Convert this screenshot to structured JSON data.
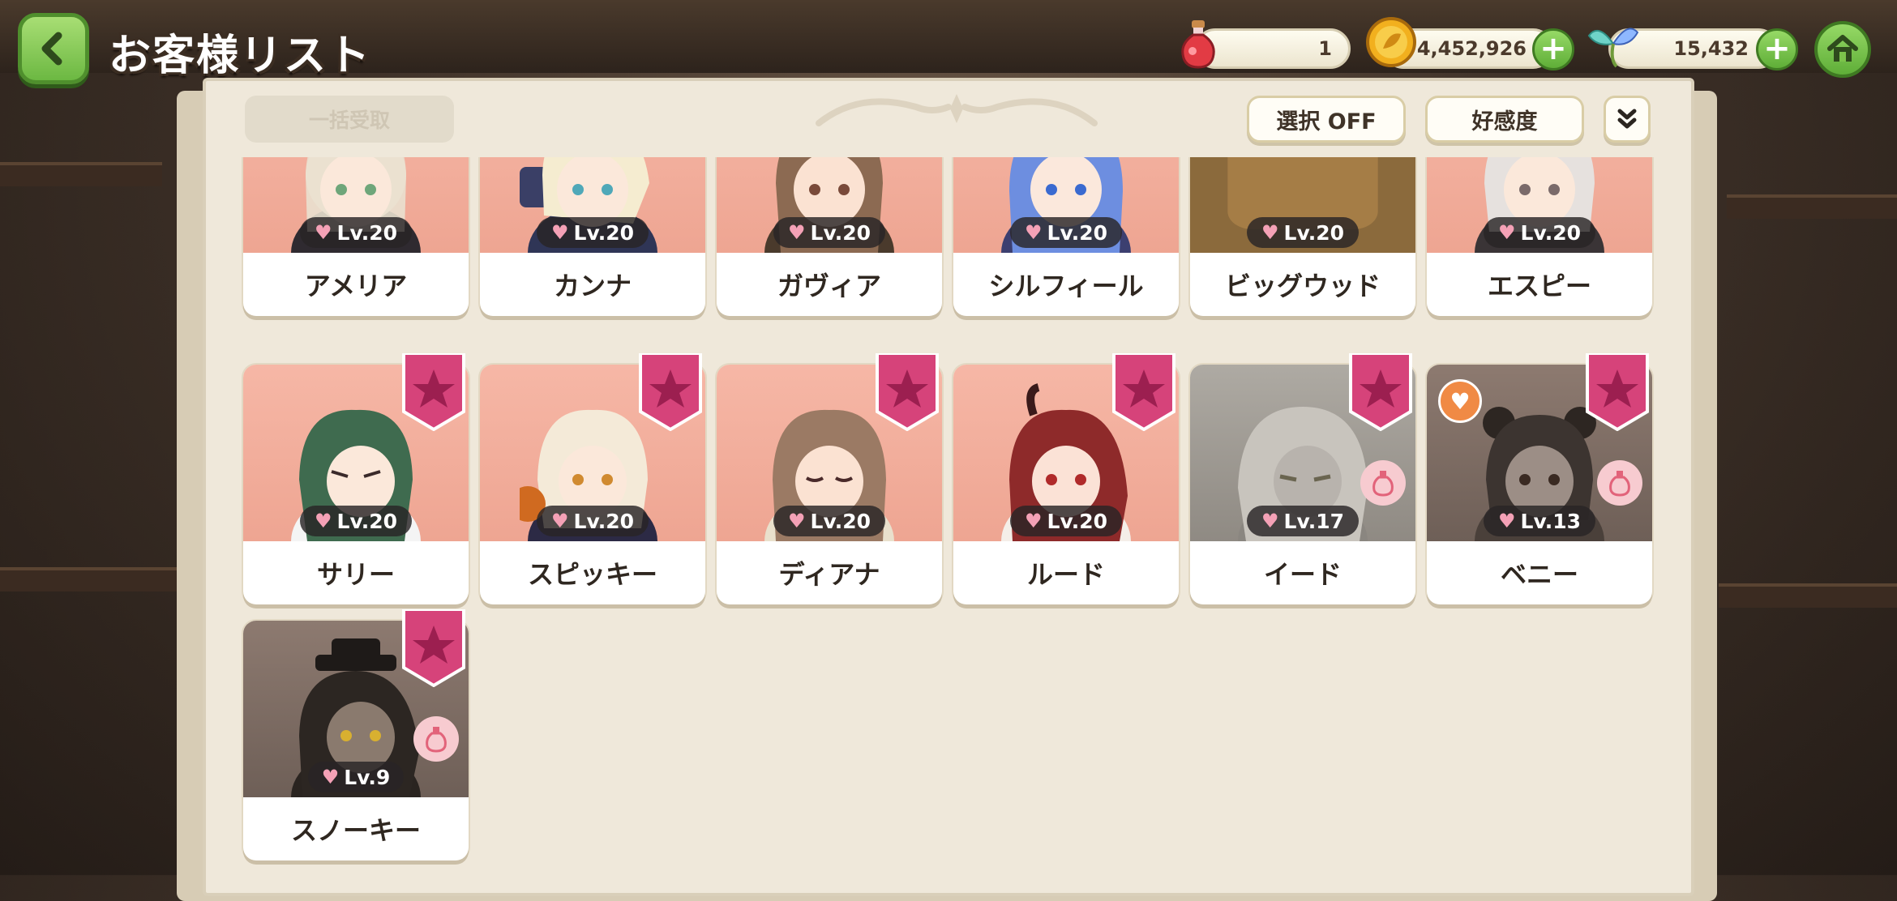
{
  "header": {
    "title": "お客様リスト"
  },
  "currencies": {
    "potion": "1",
    "gold": "4,452,926",
    "gem": "15,432"
  },
  "toolbar": {
    "bulk_receive": "一括受取",
    "select_toggle": "選択 OFF",
    "sort": "好感度"
  },
  "customers": [
    {
      "name": "アメリア",
      "level": "Lv.20"
    },
    {
      "name": "カンナ",
      "level": "Lv.20"
    },
    {
      "name": "ガヴィア",
      "level": "Lv.20"
    },
    {
      "name": "シルフィール",
      "level": "Lv.20"
    },
    {
      "name": "ビッグウッド",
      "level": "Lv.20"
    },
    {
      "name": "エスピー",
      "level": "Lv.20"
    },
    {
      "name": "サリー",
      "level": "Lv.20"
    },
    {
      "name": "スピッキー",
      "level": "Lv.20"
    },
    {
      "name": "ディアナ",
      "level": "Lv.20"
    },
    {
      "name": "ルード",
      "level": "Lv.20"
    },
    {
      "name": "イード",
      "level": "Lv.17"
    },
    {
      "name": "ベニー",
      "level": "Lv.13"
    },
    {
      "name": "スノーキー",
      "level": "Lv.9"
    }
  ],
  "colors": {
    "accent_green": "#6cb842",
    "badge_pink": "#d6437a",
    "card_pink": "#f6b7a6",
    "panel": "#efe8da"
  }
}
